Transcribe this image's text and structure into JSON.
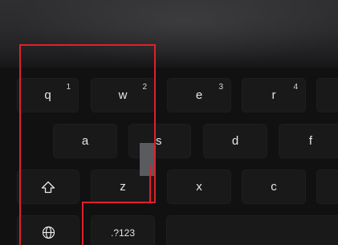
{
  "colors": {
    "background": "#121213",
    "key": "#19191a",
    "key_text": "#e6e6e6",
    "highlight": "#e0202a",
    "drag_handle": "#5a5b5e"
  },
  "keyboard": {
    "row1": [
      {
        "label": "q",
        "number": "1"
      },
      {
        "label": "w",
        "number": "2"
      },
      {
        "label": "e",
        "number": "3"
      },
      {
        "label": "r",
        "number": "4"
      }
    ],
    "row2": [
      "a",
      "s",
      "d",
      "f"
    ],
    "row3": [
      "z",
      "x",
      "c"
    ],
    "symbols_label": ".?123",
    "shift_icon": "shift-arrow-icon",
    "globe_icon": "globe-icon"
  }
}
